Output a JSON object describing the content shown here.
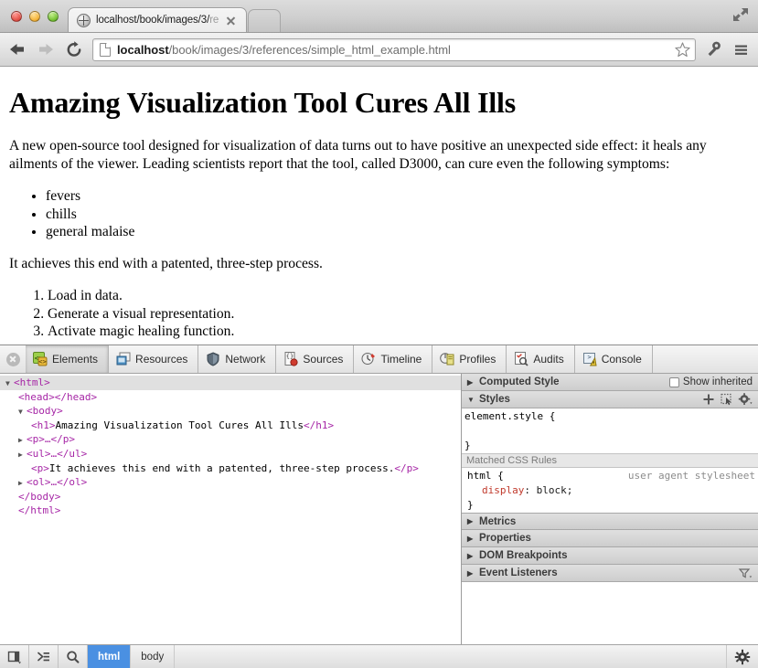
{
  "browser": {
    "window_controls": [
      "close",
      "minimize",
      "zoom"
    ],
    "expand_icon": "fullscreen-arrows-icon",
    "tab": {
      "title_visible": "localhost/book/images/3/",
      "title_dim": "re",
      "favicon": "globe-icon",
      "close_icon": "close-icon"
    },
    "nav": {
      "back": "back-arrow-icon",
      "forward": "forward-arrow-icon",
      "reload": "reload-icon"
    },
    "omnibox": {
      "page_icon": "page-document-icon",
      "host": "localhost",
      "path": "/book/images/3/references/simple_html_example.html",
      "bookmark_icon": "star-icon"
    },
    "toolbar_icons": [
      "wrench-icon",
      "menu-icon"
    ]
  },
  "page": {
    "heading": "Amazing Visualization Tool Cures All Ills",
    "paragraph1": "A new open-source tool designed for visualization of data turns out to have positive an unexpected side effect: it heals any ailments of the viewer. Leading scientists report that the tool, called D3000, can cure even the following symptoms:",
    "symptoms": [
      "fevers",
      "chills",
      "general malaise"
    ],
    "paragraph2": "It achieves this end with a patented, three-step process.",
    "steps": [
      "Load in data.",
      "Generate a visual representation.",
      "Activate magic healing function."
    ]
  },
  "devtools": {
    "close_icon": "close-icon",
    "tabs": [
      {
        "label": "Elements",
        "icon": "elements-icon",
        "active": true
      },
      {
        "label": "Resources",
        "icon": "resources-icon",
        "active": false
      },
      {
        "label": "Network",
        "icon": "network-icon",
        "active": false
      },
      {
        "label": "Sources",
        "icon": "sources-icon",
        "active": false
      },
      {
        "label": "Timeline",
        "icon": "timeline-icon",
        "active": false
      },
      {
        "label": "Profiles",
        "icon": "profiles-icon",
        "active": false
      },
      {
        "label": "Audits",
        "icon": "audits-icon",
        "active": false
      },
      {
        "label": "Console",
        "icon": "console-icon",
        "active": false
      }
    ],
    "dom": {
      "rows": [
        {
          "text": "<html>",
          "twist": "open",
          "indent": 1,
          "selected": true
        },
        {
          "text": "<head></head>",
          "twist": "none",
          "indent": 3,
          "selected": false
        },
        {
          "text": "<body>",
          "twist": "open",
          "indent": 2,
          "selected": false
        },
        {
          "text": "<h1>Amazing Visualization Tool Cures All Ills</h1>",
          "twist": "none",
          "indent": 4,
          "selected": false,
          "mixed": true
        },
        {
          "text": "<p>…</p>",
          "twist": "closed",
          "indent": 3,
          "selected": false
        },
        {
          "text": "<ul>…</ul>",
          "twist": "closed",
          "indent": 3,
          "selected": false
        },
        {
          "text": "<p>It achieves this end with a patented, three-step process.</p>",
          "twist": "none",
          "indent": 4,
          "selected": false,
          "mixed": true
        },
        {
          "text": "<ol>…</ol>",
          "twist": "closed",
          "indent": 3,
          "selected": false
        },
        {
          "text": "</body>",
          "twist": "none",
          "indent": 3,
          "selected": false
        },
        {
          "text": "</html>",
          "twist": "none",
          "indent": 2,
          "selected": false
        }
      ],
      "h1_open": "<h1>",
      "h1_text": "Amazing Visualization Tool Cures All Ills",
      "h1_close": "</h1>",
      "p_open": "<p>",
      "p_text": "It achieves this end with a patented, three-step process.",
      "p_close": "</p>"
    },
    "sidebar": {
      "computed_style": "Computed Style",
      "show_inherited": "Show inherited",
      "styles": "Styles",
      "styles_actions": [
        "add-rule-icon",
        "element-state-icon",
        "styles-settings-icon"
      ],
      "element_style_open": "element.style {",
      "element_style_close": "}",
      "matched_css_rules": "Matched CSS Rules",
      "rule_selector": "html {",
      "rule_origin": "user agent stylesheet",
      "rule_prop_name": "display",
      "rule_prop_value": " block;",
      "rule_close": "}",
      "sections": [
        "Metrics",
        "Properties",
        "DOM Breakpoints",
        "Event Listeners"
      ],
      "event_listeners_filter": "filter-icon"
    },
    "status": {
      "dock_icon": "dock-to-side-icon",
      "drawer_icon": "show-drawer-icon",
      "inspect_icon": "inspect-search-icon",
      "breadcrumbs": [
        {
          "label": "html",
          "active": true
        },
        {
          "label": "body",
          "active": false
        }
      ],
      "settings_icon": "gear-icon"
    }
  },
  "colors": {
    "tag": "#a626a6",
    "selection": "#e0e0e0",
    "breadcrumb_active": "#4a90e2",
    "property_name": "#c0392b"
  }
}
